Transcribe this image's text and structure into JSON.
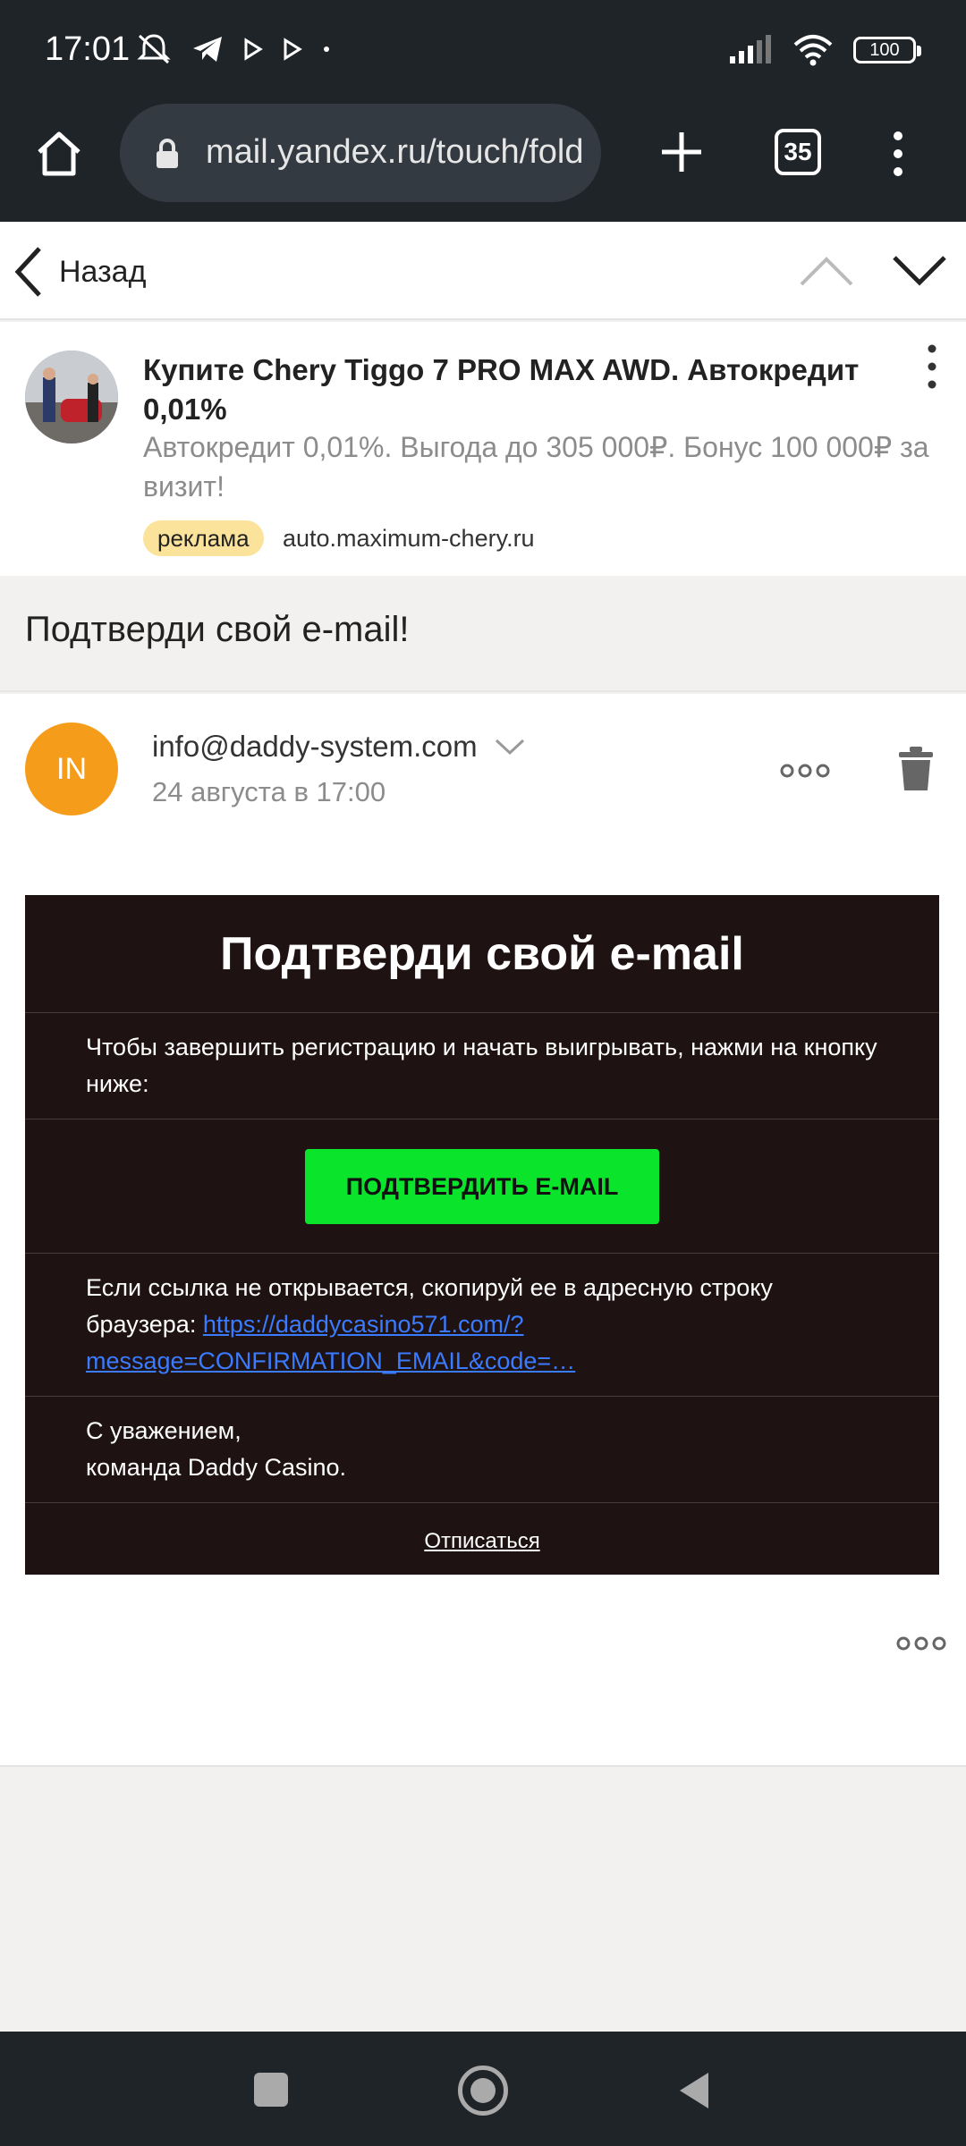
{
  "status_bar": {
    "time": "17:01",
    "battery": "100",
    "left_icons": [
      "mute-icon",
      "telegram-icon",
      "play-icon",
      "play-icon",
      "dot-icon"
    ],
    "right_icons": [
      "signal-icon",
      "wifi-icon",
      "battery-icon"
    ]
  },
  "browser": {
    "url": "mail.yandex.ru/touch/fold",
    "tab_count": "35"
  },
  "mail_header": {
    "back_label": "Назад"
  },
  "ad": {
    "title": "Купите Chery Tiggo 7 PRO MAX AWD. Автокредит 0,01%",
    "description": "Автокредит 0,01%. Выгода до 305 000₽. Бонус 100 000₽ за визит!",
    "badge": "реклама",
    "domain": "auto.maximum-chery.ru"
  },
  "subject": "Подтверди свой e-mail!",
  "message": {
    "sender_initials": "IN",
    "sender_email": "info@daddy-system.com",
    "date": "24 августа в 17:00",
    "avatar_color": "#f59c1a",
    "body": {
      "heading": "Подтверди свой e-mail",
      "intro": "Чтобы завершить регистрацию и начать выигрывать, нажми на кнопку ниже:",
      "button": "ПОДТВЕРДИТЬ E-MAIL",
      "fallback_text": "Если ссылка не открывается, скопируй ее в адресную строку браузера: ",
      "link_text": "https://daddycasino571.com/?message=CONFIRMATION_EMAIL&code=…",
      "sign_line1": "С уважением,",
      "sign_line2": "команда Daddy Casino.",
      "unsubscribe": "Отписаться",
      "button_color": "#0ae52c",
      "background_color": "#1e1212"
    }
  }
}
